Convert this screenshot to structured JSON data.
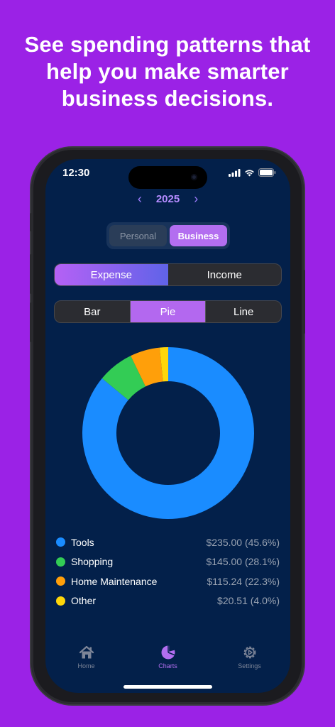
{
  "headline": "See spending patterns that\nhelp you make smarter\nbusiness decisions.",
  "status_bar": {
    "time": "12:30"
  },
  "year_nav": {
    "prev": "‹",
    "year": "2025",
    "next": "›"
  },
  "account_toggle": {
    "options": [
      "Personal",
      "Business"
    ],
    "selected": "Business"
  },
  "type_toggle": {
    "options": [
      "Expense",
      "Income"
    ],
    "selected": "Expense"
  },
  "chart_toggle": {
    "options": [
      "Bar",
      "Pie",
      "Line"
    ],
    "selected": "Pie"
  },
  "chart_data": {
    "type": "pie",
    "categories": [
      "Tools",
      "Shopping",
      "Home Maintenance",
      "Other"
    ],
    "values": [
      235.0,
      145.0,
      115.24,
      20.51
    ],
    "donut_arc_percent": [
      86.0,
      6.8,
      5.6,
      1.6
    ],
    "colors": [
      "#1a8cff",
      "#33cc55",
      "#ff9f0a",
      "#ffd60a"
    ]
  },
  "legend": [
    {
      "name": "Tools",
      "value": "$235.00 (45.6%)",
      "color": "#1a8cff"
    },
    {
      "name": "Shopping",
      "value": "$145.00 (28.1%)",
      "color": "#33cc55"
    },
    {
      "name": "Home Maintenance",
      "value": "$115.24 (22.3%)",
      "color": "#ff9f0a"
    },
    {
      "name": "Other",
      "value": "$20.51 (4.0%)",
      "color": "#ffd60a"
    }
  ],
  "tabbar": {
    "items": [
      {
        "label": "Home",
        "icon": "house-icon"
      },
      {
        "label": "Charts",
        "icon": "pie-chart-icon"
      },
      {
        "label": "Settings",
        "icon": "gear-icon"
      }
    ],
    "active": "Charts"
  },
  "colors": {
    "background": "#9b22e6",
    "screen": "#03204a",
    "accent": "#b36ef0"
  }
}
